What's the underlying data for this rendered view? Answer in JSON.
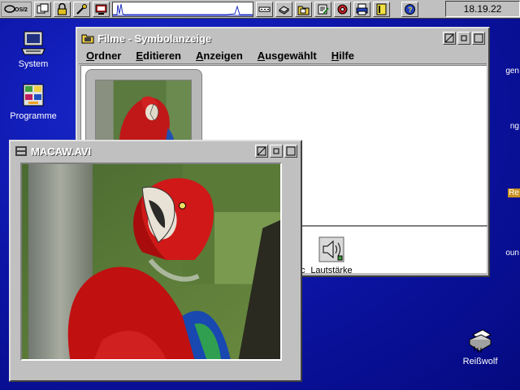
{
  "warpcenter": {
    "os2_logo": "os2-logo-icon",
    "buttons": [
      "window-list-icon",
      "lock-icon",
      "tools-icon",
      "monitor-icon"
    ],
    "right_buttons": [
      "drives-icon",
      "disk-icon",
      "folder-icon",
      "edit-icon",
      "settings-icon",
      "printer-icon",
      "notes-icon"
    ],
    "help_icon": "help-icon",
    "clock": "18.19.22"
  },
  "desktop": {
    "icons": [
      {
        "label": "System",
        "icon": "computer-icon"
      },
      {
        "label": "Programme",
        "icon": "programs-icon"
      },
      {
        "label": "Reißwolf",
        "icon": "shredder-icon"
      }
    ],
    "edge_texts": [
      "gen",
      "ng",
      "Re",
      "oun"
    ]
  },
  "window_filme": {
    "title": "Filme - Symbolanzeige",
    "menu": [
      {
        "label": "Ordner",
        "accel": "O",
        "rest": "rdner"
      },
      {
        "label": "Editieren",
        "accel": "E",
        "rest": "ditieren"
      },
      {
        "label": "Anzeigen",
        "accel": "A",
        "rest": "nzeigen"
      },
      {
        "label": "Ausgewählt",
        "accel": "A",
        "rest": "usgewählt"
      },
      {
        "label": "Hilfe",
        "accel": "H",
        "rest": "ilfe"
      }
    ],
    "lower_icon": {
      "label": "Lautstärke",
      "icon": "volume-icon"
    },
    "partial_label": "c"
  },
  "window_video": {
    "title": "MACAW.AVI"
  },
  "colors": {
    "desktop": "#0d15a8",
    "window_face": "#c0c0c0",
    "title_text": "#ffffff"
  }
}
